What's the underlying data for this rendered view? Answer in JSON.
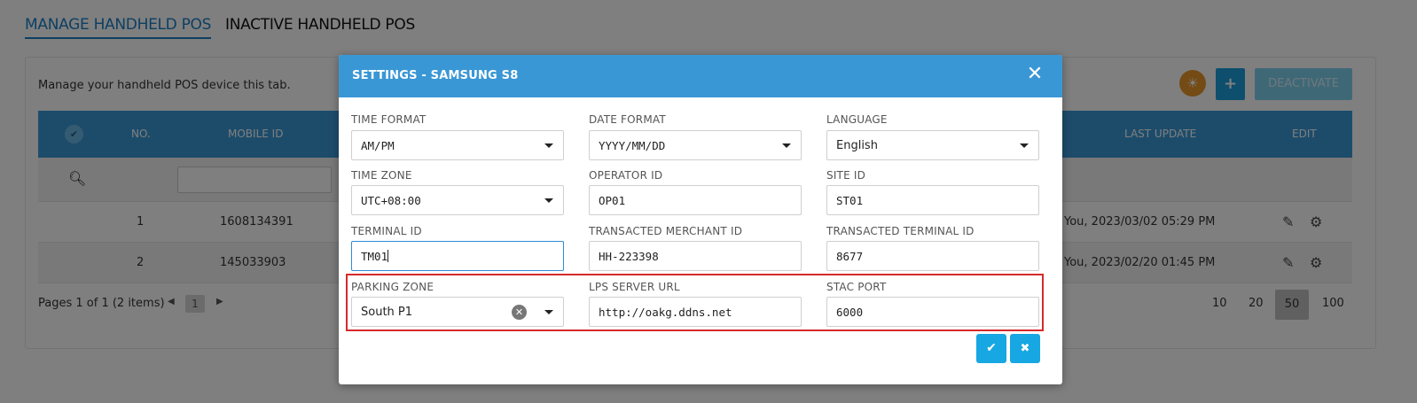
{
  "tabs": {
    "manage": "MANAGE HANDHELD POS",
    "inactive": "INACTIVE HANDHELD POS"
  },
  "card": {
    "description": "Manage your handheld POS device this tab.",
    "add_label": "+",
    "deactivate_label": "DEACTIVATE"
  },
  "grid": {
    "columns": {
      "no": "NO.",
      "mobile_id": "MOBILE ID",
      "last_update": "LAST UPDATE",
      "edit": "EDIT"
    },
    "rows": [
      {
        "no": "1",
        "mobile_id": "1608134391",
        "last_update": "You, 2023/03/02 05:29 PM"
      },
      {
        "no": "2",
        "mobile_id": "145033903",
        "last_update": "You, 2023/02/20 01:45 PM"
      }
    ]
  },
  "pager": {
    "info": "Pages 1 of 1 (2 items)",
    "current_page": "1",
    "page_sizes": [
      "10",
      "20",
      "50",
      "100"
    ],
    "active_size": "50"
  },
  "modal": {
    "title": "SETTINGS - SAMSUNG S8",
    "fields": {
      "time_format": {
        "label": "TIME FORMAT",
        "value": "AM/PM"
      },
      "date_format": {
        "label": "DATE FORMAT",
        "value": "YYYY/MM/DD"
      },
      "language": {
        "label": "LANGUAGE",
        "value": "English"
      },
      "time_zone": {
        "label": "TIME ZONE",
        "value": "UTC+08:00"
      },
      "operator_id": {
        "label": "OPERATOR ID",
        "value": "OP01"
      },
      "site_id": {
        "label": "SITE ID",
        "value": "ST01"
      },
      "terminal_id": {
        "label": "TERMINAL ID",
        "value": "TM01"
      },
      "transacted_merchant_id": {
        "label": "TRANSACTED MERCHANT ID",
        "value": "HH-223398"
      },
      "transacted_terminal_id": {
        "label": "TRANSACTED TERMINAL ID",
        "value": "8677"
      },
      "parking_zone": {
        "label": "PARKING ZONE",
        "value": "South P1"
      },
      "lps_server_url": {
        "label": "LPS SERVER URL",
        "value": "http://oakg.ddns.net"
      },
      "stac_port": {
        "label": "STAC PORT",
        "value": "6000"
      }
    }
  },
  "colors": {
    "accent": "#3a97d5",
    "action_button": "#17a7e2",
    "highlight": "#d62a2a"
  }
}
